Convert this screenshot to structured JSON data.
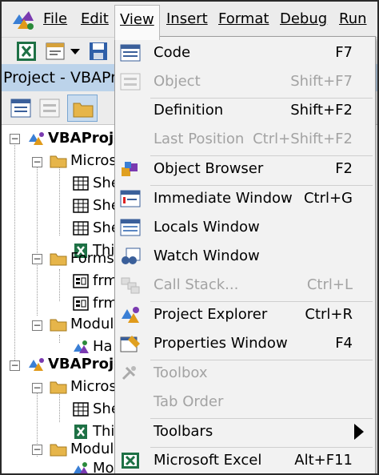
{
  "menubar": {
    "items": [
      {
        "id": "file",
        "label": "File"
      },
      {
        "id": "edit",
        "label": "Edit"
      },
      {
        "id": "view",
        "label": "View"
      },
      {
        "id": "insert",
        "label": "Insert"
      },
      {
        "id": "format",
        "label": "Format"
      },
      {
        "id": "debug",
        "label": "Debug"
      },
      {
        "id": "run",
        "label": "Run"
      }
    ]
  },
  "project_pane": {
    "title": "Project - VBAProj"
  },
  "tree": {
    "nodes": [
      {
        "label": "VBAProje",
        "bold": true
      },
      {
        "label": "Micros"
      },
      {
        "label": "She"
      },
      {
        "label": "She"
      },
      {
        "label": "She"
      },
      {
        "label": "Thi"
      },
      {
        "label": "Forms"
      },
      {
        "label": "frm"
      },
      {
        "label": "frm"
      },
      {
        "label": "Module"
      },
      {
        "label": "Ha"
      },
      {
        "label": "VBAProje",
        "bold": true
      },
      {
        "label": "Micros"
      },
      {
        "label": "She"
      },
      {
        "label": "Thi"
      },
      {
        "label": "Module"
      },
      {
        "label": "Mo"
      }
    ]
  },
  "view_menu": {
    "items": [
      {
        "label": "Code",
        "shortcut": "F7",
        "icon": "code-window-icon",
        "disabled": false
      },
      {
        "label": "Object",
        "shortcut": "Shift+F7",
        "icon": "object-icon",
        "disabled": true
      },
      {
        "label": "Definition",
        "shortcut": "Shift+F2",
        "icon": "",
        "disabled": false
      },
      {
        "label": "Last Position",
        "shortcut": "Ctrl+Shift+F2",
        "icon": "",
        "disabled": true
      },
      {
        "label": "Object Browser",
        "shortcut": "F2",
        "icon": "object-browser-icon",
        "disabled": false
      },
      {
        "label": "Immediate Window",
        "shortcut": "Ctrl+G",
        "icon": "immediate-window-icon",
        "disabled": false
      },
      {
        "label": "Locals Window",
        "shortcut": "",
        "icon": "locals-window-icon",
        "disabled": false
      },
      {
        "label": "Watch Window",
        "shortcut": "",
        "icon": "watch-window-icon",
        "disabled": false
      },
      {
        "label": "Call Stack...",
        "shortcut": "Ctrl+L",
        "icon": "call-stack-icon",
        "disabled": true
      },
      {
        "label": "Project Explorer",
        "shortcut": "Ctrl+R",
        "icon": "project-explorer-icon",
        "disabled": false
      },
      {
        "label": "Properties Window",
        "shortcut": "F4",
        "icon": "properties-window-icon",
        "disabled": false
      },
      {
        "label": "Toolbox",
        "shortcut": "",
        "icon": "toolbox-icon",
        "disabled": true
      },
      {
        "label": "Tab Order",
        "shortcut": "",
        "icon": "",
        "disabled": true
      },
      {
        "label": "Toolbars",
        "shortcut": "",
        "icon": "",
        "disabled": false,
        "submenu": true
      },
      {
        "label": "Microsoft Excel",
        "shortcut": "Alt+F11",
        "icon": "excel-icon",
        "disabled": false
      }
    ]
  },
  "colors": {
    "menu_background": "#f2f2f2",
    "title_bar": "#bcd3ea",
    "disabled_text": "#a3a3a3",
    "excel_green": "#1e7145"
  }
}
